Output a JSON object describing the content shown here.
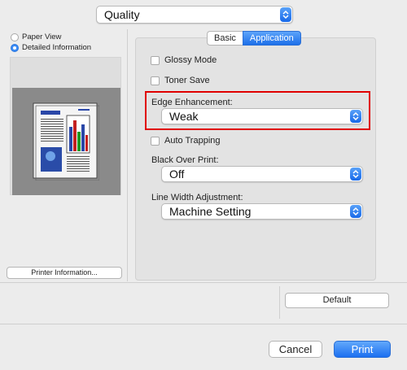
{
  "header": {
    "feature_set": "Quality"
  },
  "preview": {
    "options": [
      {
        "label": "Paper View",
        "selected": false
      },
      {
        "label": "Detailed Information",
        "selected": true
      }
    ],
    "printer_info_label": "Printer Information..."
  },
  "tabs": [
    {
      "label": "Basic",
      "active": false
    },
    {
      "label": "Application",
      "active": true
    }
  ],
  "settings": {
    "glossy_mode": {
      "label": "Glossy Mode",
      "checked": false
    },
    "toner_save": {
      "label": "Toner Save",
      "checked": false
    },
    "edge_enhancement": {
      "label": "Edge Enhancement:",
      "value": "Weak"
    },
    "auto_trapping": {
      "label": "Auto Trapping",
      "checked": false
    },
    "black_over_print": {
      "label": "Black Over Print:",
      "value": "Off"
    },
    "line_width_adjustment": {
      "label": "Line Width Adjustment:",
      "value": "Machine Setting"
    }
  },
  "buttons": {
    "default": "Default",
    "cancel": "Cancel",
    "print": "Print"
  },
  "colors": {
    "accent": "#1d6fe9",
    "highlight": "#e00000"
  }
}
